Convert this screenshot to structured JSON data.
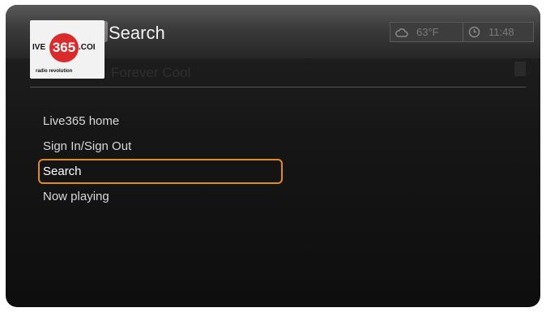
{
  "header": {
    "title": "Search",
    "logo": {
      "left": "IVE",
      "number": "365",
      "right": ".COI",
      "tagline": "radio revolution"
    },
    "weather": {
      "icon": "cloud-icon",
      "value": "63°F"
    },
    "clock": {
      "icon": "clock-icon",
      "value": "11:48"
    },
    "background_title": "Forever Cool"
  },
  "menu": {
    "items": [
      {
        "label": "Live365 home"
      },
      {
        "label": "Sign In/Sign Out"
      },
      {
        "label": "Search",
        "selected": true
      },
      {
        "label": "Now playing"
      }
    ]
  },
  "colors": {
    "accent": "#e28b22",
    "background": "#161616",
    "text": "#d8d8d8"
  }
}
